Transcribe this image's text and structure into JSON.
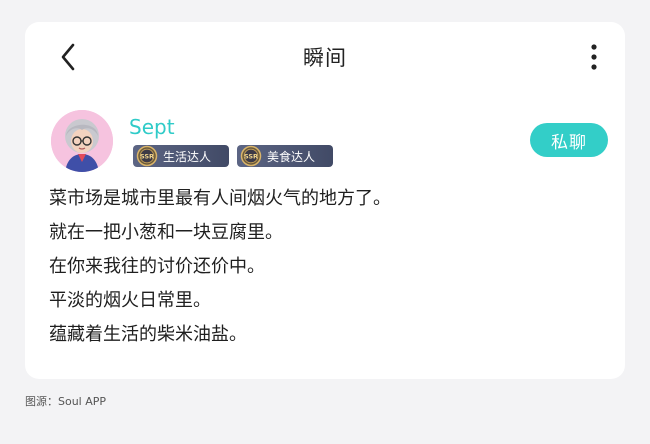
{
  "header": {
    "title": "瞬间",
    "back_icon": "chevron-left-icon",
    "more_icon": "vertical-ellipsis-icon"
  },
  "user": {
    "name": "Sept",
    "avatar_icon": "avatar-icon",
    "badges": [
      {
        "level": "SSR",
        "label": "生活达人"
      },
      {
        "level": "SSR",
        "label": "美食达人"
      }
    ],
    "chat_button": "私聊"
  },
  "post": {
    "lines": [
      "菜市场是城市里最有人间烟火气的地方了。",
      "就在一把小葱和一块豆腐里。",
      "在你来我往的讨价还价中。",
      "平淡的烟火日常里。",
      "蕴藏着生活的柴米油盐。"
    ]
  },
  "caption": "图源：Soul APP",
  "colors": {
    "accent": "#33cec8",
    "username": "#2fcbc8",
    "badge_bg": "#4b5474",
    "card_bg": "#ffffff",
    "page_bg": "#f3f3f5"
  }
}
